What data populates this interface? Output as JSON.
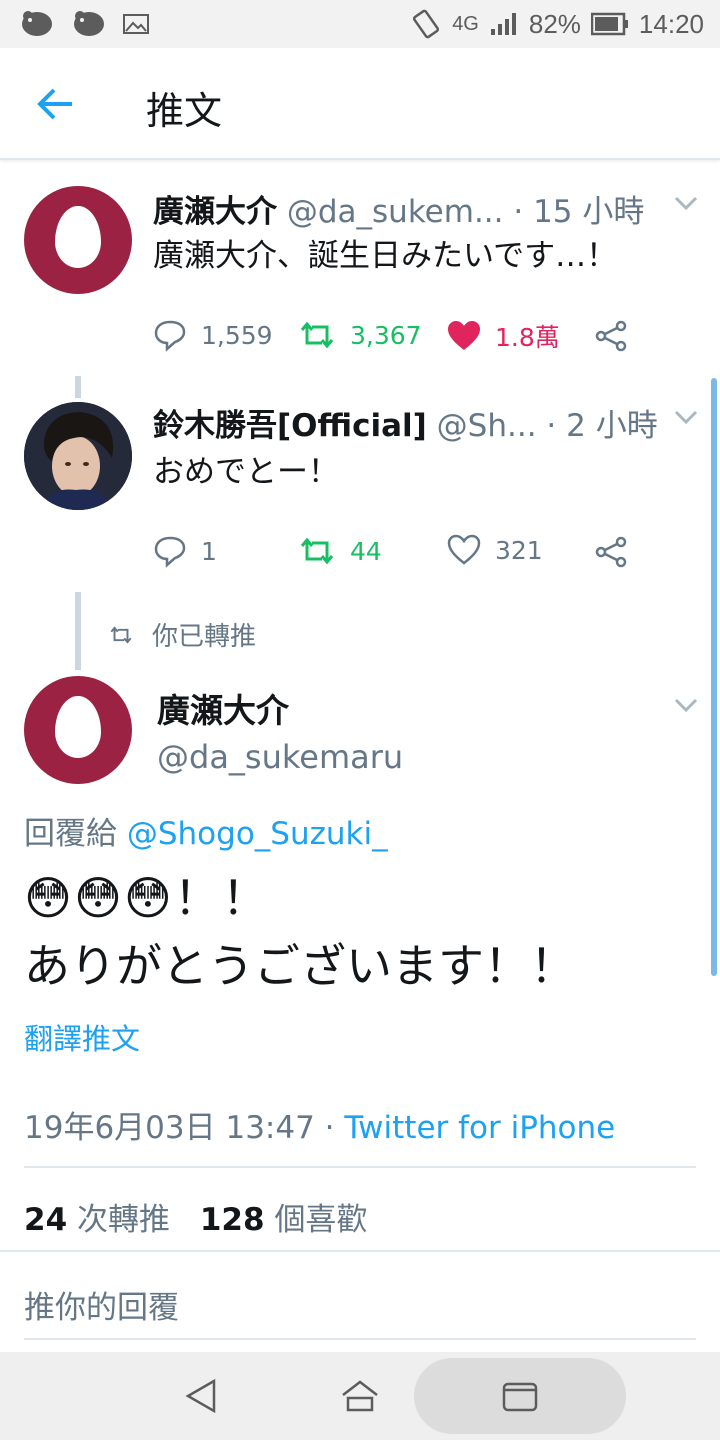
{
  "status_bar": {
    "battery": "82%",
    "time": "14:20",
    "network": "4G"
  },
  "app_bar": {
    "title": "推文"
  },
  "tweets": [
    {
      "name": "廣瀬大介",
      "handle": "@da_sukem...",
      "time": "· 15 小時",
      "text": "廣瀬大介、誕生日みたいです…！",
      "replies": "1,559",
      "retweets": "3,367",
      "likes": "1.8萬",
      "liked": true,
      "retweeted": true,
      "avatar": "egg-avatar"
    },
    {
      "name": "鈴木勝吾[Official]",
      "handle": "@Sh...",
      "time": "· 2 小時",
      "text": "おめでとー！",
      "replies": "1",
      "retweets": "44",
      "likes": "321",
      "liked": false,
      "retweeted": true,
      "avatar": "photo-avatar"
    }
  ],
  "focused": {
    "retweet_notice": "你已轉推",
    "name": "廣瀬大介",
    "handle": "@da_sukemaru",
    "reply_prefix": "回覆給",
    "reply_to": "@Shogo_Suzuki_",
    "emoji_line": "😳😳😳！！",
    "text_line": "ありがとうございます！！",
    "translate": "翻譯推文",
    "date": "19年6月03日 13:47 ·",
    "source": "Twitter for iPhone",
    "retweet_count": "24",
    "retweet_label": "次轉推",
    "like_count": "128",
    "like_label": "個喜歡",
    "reply_placeholder": "推你的回覆"
  },
  "colors": {
    "accent": "#1da1f2",
    "retweet_green": "#17bf63",
    "like_pink": "#e0245e",
    "egg_bg": "#9b2242"
  }
}
